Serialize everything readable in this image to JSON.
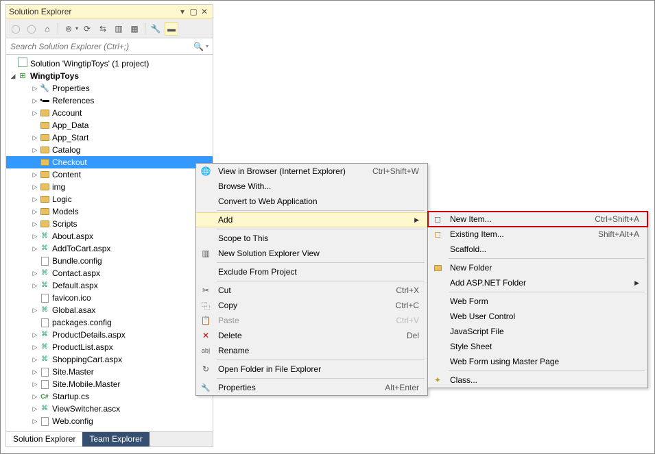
{
  "panel": {
    "title": "Solution Explorer",
    "search_placeholder": "Search Solution Explorer (Ctrl+;)"
  },
  "tree": {
    "solution": "Solution 'WingtipToys' (1 project)",
    "project": "WingtipToys",
    "items": [
      {
        "label": "Properties",
        "icon": "wrench",
        "tw": "▷",
        "depth": 2
      },
      {
        "label": "References",
        "icon": "ref",
        "tw": "▷",
        "depth": 2
      },
      {
        "label": "Account",
        "icon": "folder",
        "tw": "▷",
        "depth": 2
      },
      {
        "label": "App_Data",
        "icon": "folder",
        "tw": "",
        "depth": 2
      },
      {
        "label": "App_Start",
        "icon": "folder",
        "tw": "▷",
        "depth": 2
      },
      {
        "label": "Catalog",
        "icon": "folder",
        "tw": "▷",
        "depth": 2
      },
      {
        "label": "Checkout",
        "icon": "folder-open",
        "tw": "",
        "depth": 2,
        "selected": true
      },
      {
        "label": "Content",
        "icon": "folder",
        "tw": "▷",
        "depth": 2
      },
      {
        "label": "img",
        "icon": "folder",
        "tw": "▷",
        "depth": 2
      },
      {
        "label": "Logic",
        "icon": "folder",
        "tw": "▷",
        "depth": 2
      },
      {
        "label": "Models",
        "icon": "folder",
        "tw": "▷",
        "depth": 2
      },
      {
        "label": "Scripts",
        "icon": "folder",
        "tw": "▷",
        "depth": 2
      },
      {
        "label": "About.aspx",
        "icon": "aspx",
        "tw": "▷",
        "depth": 2
      },
      {
        "label": "AddToCart.aspx",
        "icon": "aspx",
        "tw": "▷",
        "depth": 2
      },
      {
        "label": "Bundle.config",
        "icon": "config",
        "tw": "",
        "depth": 2
      },
      {
        "label": "Contact.aspx",
        "icon": "aspx",
        "tw": "▷",
        "depth": 2
      },
      {
        "label": "Default.aspx",
        "icon": "aspx",
        "tw": "▷",
        "depth": 2
      },
      {
        "label": "favicon.ico",
        "icon": "file",
        "tw": "",
        "depth": 2
      },
      {
        "label": "Global.asax",
        "icon": "aspx",
        "tw": "▷",
        "depth": 2
      },
      {
        "label": "packages.config",
        "icon": "config",
        "tw": "",
        "depth": 2
      },
      {
        "label": "ProductDetails.aspx",
        "icon": "aspx",
        "tw": "▷",
        "depth": 2
      },
      {
        "label": "ProductList.aspx",
        "icon": "aspx",
        "tw": "▷",
        "depth": 2
      },
      {
        "label": "ShoppingCart.aspx",
        "icon": "aspx",
        "tw": "▷",
        "depth": 2
      },
      {
        "label": "Site.Master",
        "icon": "file",
        "tw": "▷",
        "depth": 2
      },
      {
        "label": "Site.Mobile.Master",
        "icon": "file",
        "tw": "▷",
        "depth": 2
      },
      {
        "label": "Startup.cs",
        "icon": "cs",
        "tw": "▷",
        "depth": 2
      },
      {
        "label": "ViewSwitcher.ascx",
        "icon": "aspx",
        "tw": "▷",
        "depth": 2
      },
      {
        "label": "Web.config",
        "icon": "config",
        "tw": "▷",
        "depth": 2
      }
    ]
  },
  "tabs": {
    "solution_explorer": "Solution Explorer",
    "team_explorer": "Team Explorer"
  },
  "context_menu": [
    {
      "label": "View in Browser (Internet Explorer)",
      "icon": "globe",
      "short": "Ctrl+Shift+W"
    },
    {
      "label": "Browse With..."
    },
    {
      "label": "Convert to Web Application"
    },
    {
      "sep": true
    },
    {
      "label": "Add",
      "highlight": true,
      "arrow": true
    },
    {
      "sep": true
    },
    {
      "label": "Scope to This"
    },
    {
      "label": "New Solution Explorer View",
      "icon": "newview"
    },
    {
      "sep": true
    },
    {
      "label": "Exclude From Project"
    },
    {
      "sep": true
    },
    {
      "label": "Cut",
      "icon": "cut",
      "short": "Ctrl+X"
    },
    {
      "label": "Copy",
      "icon": "copy",
      "short": "Ctrl+C"
    },
    {
      "label": "Paste",
      "icon": "paste",
      "short": "Ctrl+V",
      "disabled": true
    },
    {
      "label": "Delete",
      "icon": "delete",
      "short": "Del"
    },
    {
      "label": "Rename",
      "icon": "rename"
    },
    {
      "sep": true
    },
    {
      "label": "Open Folder in File Explorer",
      "icon": "openfolder"
    },
    {
      "sep": true
    },
    {
      "label": "Properties",
      "icon": "wrench",
      "short": "Alt+Enter"
    }
  ],
  "sub_menu": [
    {
      "label": "New Item...",
      "icon": "newitem",
      "short": "Ctrl+Shift+A",
      "boxed": true
    },
    {
      "label": "Existing Item...",
      "icon": "existitem",
      "short": "Shift+Alt+A"
    },
    {
      "label": "Scaffold..."
    },
    {
      "sep": true
    },
    {
      "label": "New Folder",
      "icon": "newfolder"
    },
    {
      "label": "Add ASP.NET Folder",
      "arrow": true
    },
    {
      "sep": true
    },
    {
      "label": "Web Form"
    },
    {
      "label": "Web User Control"
    },
    {
      "label": "JavaScript File"
    },
    {
      "label": "Style Sheet"
    },
    {
      "label": "Web Form using Master Page"
    },
    {
      "sep": true
    },
    {
      "label": "Class...",
      "icon": "class"
    }
  ]
}
